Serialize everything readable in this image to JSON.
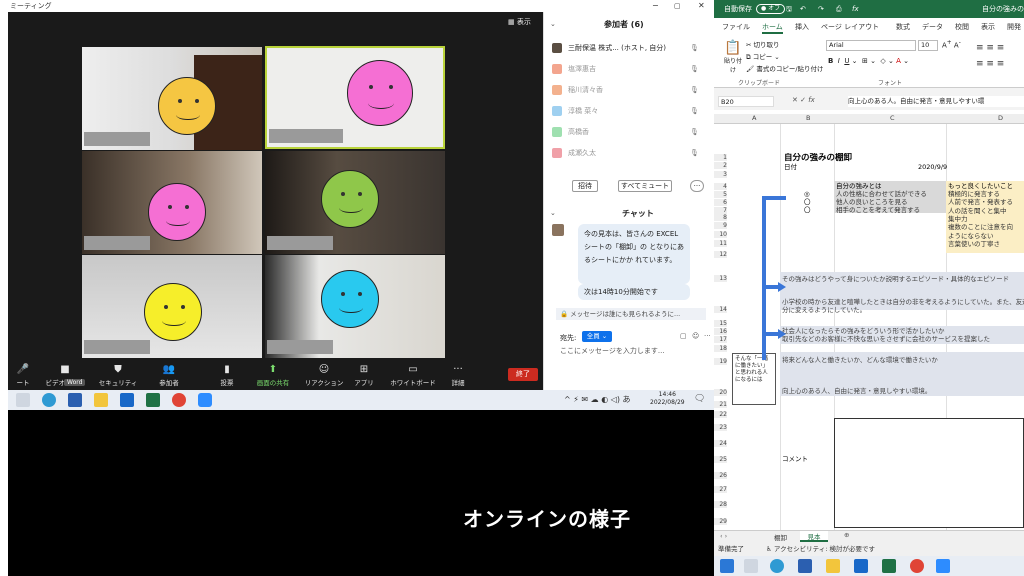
{
  "zoom": {
    "title": "ミーティング",
    "view_label": "表示",
    "participants_header": "参加者 (6)",
    "participants": [
      {
        "name": "三耐保温 株式... (ホスト, 自分)",
        "color": "#5a4e42"
      },
      {
        "name": "塩澤惠吉",
        "color": "#f3a58e"
      },
      {
        "name": "稲川清々香",
        "color": "#f3b18e"
      },
      {
        "name": "淳橋 菜々",
        "color": "#9fd0f0"
      },
      {
        "name": "高橋香",
        "color": "#9fe0b0"
      },
      {
        "name": "成瀬久太",
        "color": "#f0a0a8"
      }
    ],
    "invite_label": "招待",
    "mute_all_label": "すべてミュート",
    "more_label": "···",
    "chat_header": "チャット",
    "chat_messages": [
      "今の見本は、皆さんの EXCELシートの「棚卸」の となりにあるシートにかか れています。",
      "次は14時10分開始です"
    ],
    "chat_notice": "メッセージは誰にも見られるように...",
    "send_to_label": "宛先:",
    "send_to_value": "全員",
    "chat_placeholder": "ここにメッセージを入力します...",
    "toolbar": [
      {
        "label": "ート",
        "icon": "🎤"
      },
      {
        "label": "ビデオの停止",
        "icon": "■"
      },
      {
        "label": "セキュリティ",
        "icon": "⛊"
      },
      {
        "label": "参加者",
        "icon": "👥"
      },
      {
        "label": "投票",
        "icon": "▮"
      },
      {
        "label": "画面の共有",
        "icon": "⬆"
      },
      {
        "label": "リアクション",
        "icon": "☺"
      },
      {
        "label": "アプリ",
        "icon": "⊞"
      },
      {
        "label": "ホワイトボード",
        "icon": "▭"
      },
      {
        "label": "詳細",
        "icon": "···"
      }
    ],
    "tooltip": "Word",
    "end_label": "終了",
    "faces": [
      "#f5c642",
      "#f56fd3",
      "#f56fd3",
      "#8fc74a",
      "#f6ee2a",
      "#29c9ef"
    ]
  },
  "taskbar_left": {
    "time": "14:46",
    "date": "2022/08/29"
  },
  "caption": "オンラインの様子",
  "excel": {
    "autosave": "自動保存",
    "autosave_state": "オフ",
    "title": "自分の強みの棚卸",
    "tabs": [
      "ファイル",
      "ホーム",
      "挿入",
      "ページ レイアウト",
      "数式",
      "データ",
      "校閲",
      "表示",
      "開発"
    ],
    "font": "Arial",
    "font_size": "10",
    "clipboard_label": "クリップボード",
    "font_label": "フォント",
    "paste_label": "貼り付け",
    "cut_label": "切り取り",
    "copy_label": "コピー",
    "format_copy_label": "書式のコピー/貼り付け",
    "name_box": "B20",
    "formula": "向上心のある人。自由に発言・意見しやすい環",
    "columns": [
      "A",
      "B",
      "C",
      "D"
    ],
    "cells": {
      "title": "自分の強みの棚卸",
      "date_label": "日付",
      "date": "2020/9/9",
      "strength_header": "自分の強みとは",
      "strengths": [
        "人の性格に合わせて話ができる",
        "他人の良いところを見る",
        "相手のことを考えて発言する"
      ],
      "marks": [
        "◎",
        "〇",
        "〇"
      ],
      "improve_header": "もっと良くしたいこと",
      "improve": [
        "積極的に発言する",
        "人前で発言・発表する",
        "人の話を聞くと集中",
        "集中力",
        "複数のことに注意を向",
        "ようにならない",
        "言葉使いの丁寧さ"
      ],
      "r13": "その強みはどうやって身についたか説明するエピソード・具体的なエピソード",
      "r14": "小学校の時から友達と喧嘩したときは自分の非を考えるようにしていた。また、友達",
      "r14b": "分に変えるようにしていた。",
      "r16": "社会人になったらその強みをどういう形で活かしたいか",
      "r17": "取引先などのお客様に不快な思いをさせずに会社のサービスを提案した",
      "r19": "将来どんな人と働きたいか、どんな環境で働きたいか",
      "r20": "向上心のある人、自由に発言・意見しやすい環境。",
      "note": "そんな「一緒に働きたい」と思われる人になるには",
      "comment_label": "コメント"
    },
    "sheets": [
      "棚卸",
      "見本"
    ],
    "status_ready": "準備完了",
    "accessibility": "アクセシビリティ: 検討が必要です"
  }
}
